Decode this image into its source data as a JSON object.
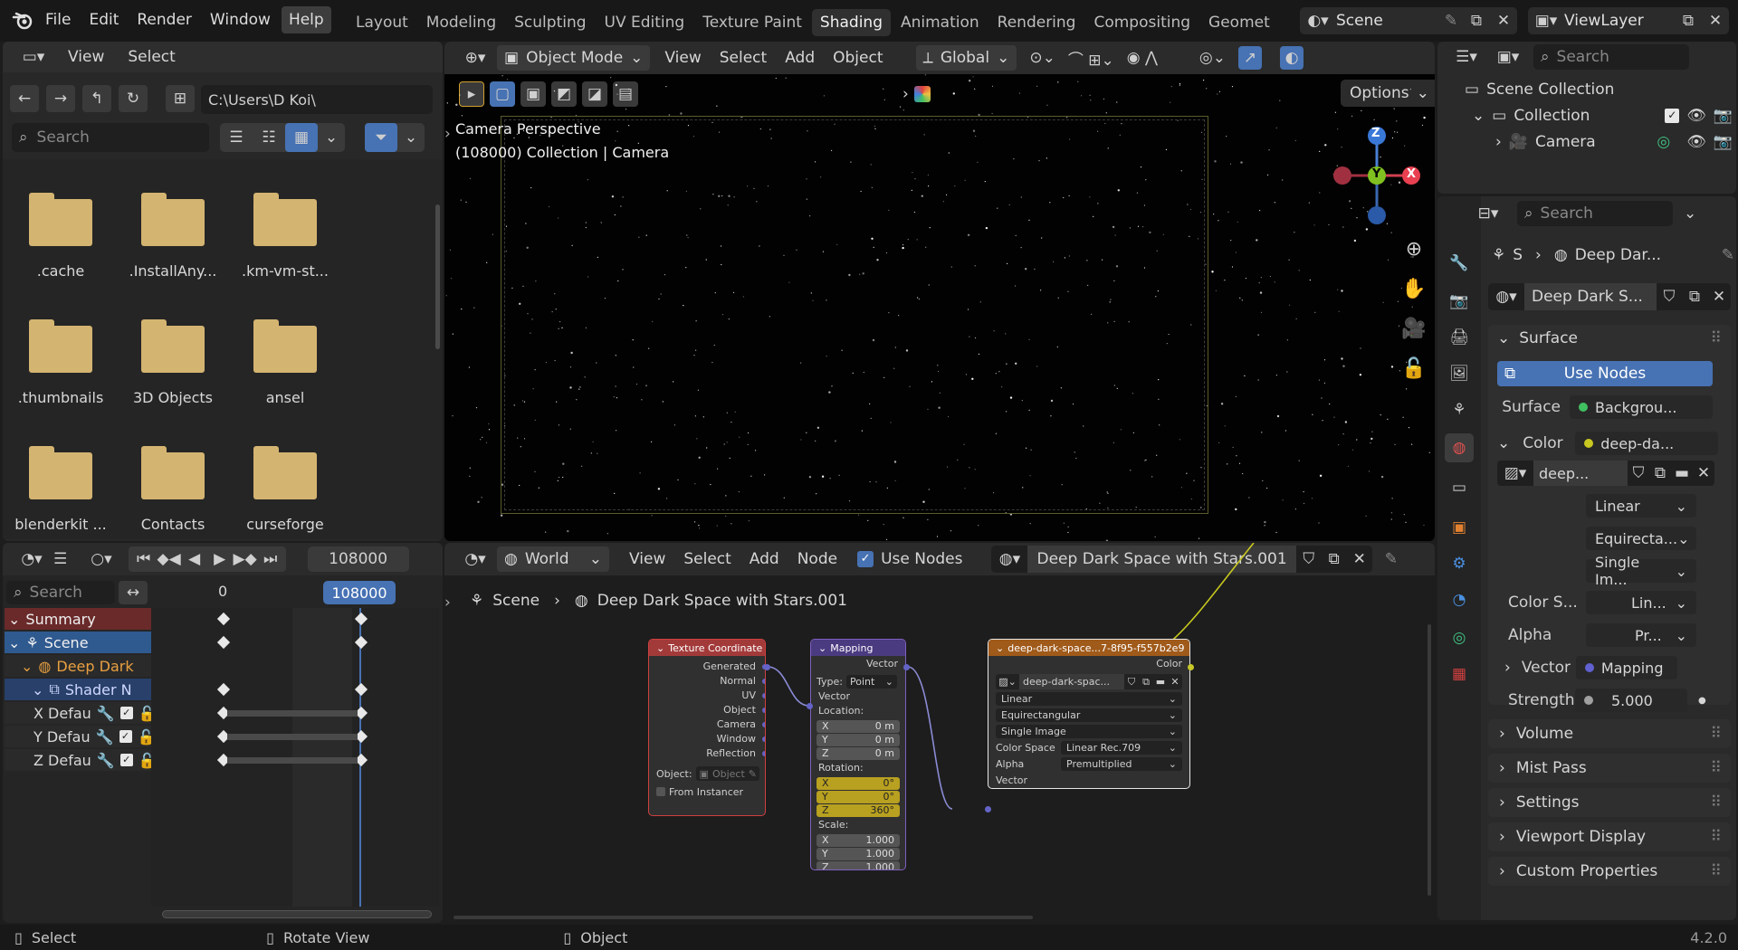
{
  "menu": {
    "file": "File",
    "edit": "Edit",
    "render": "Render",
    "window": "Window",
    "help": "Help"
  },
  "workspaces": [
    "Layout",
    "Modeling",
    "Sculpting",
    "UV Editing",
    "Texture Paint",
    "Shading",
    "Animation",
    "Rendering",
    "Compositing",
    "Geomet"
  ],
  "scene_name": "Scene",
  "view_layer": "ViewLayer",
  "filebrowser": {
    "view": "View",
    "select": "Select",
    "path": "C:\\Users\\D Koi\\",
    "search_placeholder": "Search",
    "folders": [
      ".cache",
      ".InstallAny...",
      ".km-vm-st...",
      ".thumbnails",
      "3D Objects",
      "ansel",
      "blenderkit ...",
      "Contacts",
      "curseforge"
    ]
  },
  "viewport": {
    "mode": "Object Mode",
    "view": "View",
    "select": "Select",
    "add": "Add",
    "object": "Object",
    "orientation": "Global",
    "options": "Options",
    "overlay_line1": "Camera Perspective",
    "overlay_line2": "(108000) Collection | Camera",
    "gizmo": {
      "z": "Z",
      "y": "Y",
      "x": "X"
    }
  },
  "outliner": {
    "search_placeholder": "Search",
    "scene_collection": "Scene Collection",
    "collection": "Collection",
    "camera": "Camera"
  },
  "properties": {
    "search_placeholder": "Search",
    "breadcrumb_s": "S",
    "breadcrumb_world": "Deep Dar...",
    "world_name": "Deep Dark S...",
    "surface_panel": "Surface",
    "use_nodes": "Use Nodes",
    "surface_label": "Surface",
    "surface_value": "Backgrou...",
    "color_label": "Color",
    "color_value": "deep-da...",
    "image_name": "deep...",
    "interp": "Linear",
    "projection": "Equirecta...",
    "source": "Single Im...",
    "colorspace_label": "Color S...",
    "colorspace_value": "Lin...",
    "alpha_label": "Alpha",
    "alpha_value": "Pr...",
    "vector_label": "Vector",
    "vector_value": "Mapping",
    "strength_label": "Strength",
    "strength_value": "5.000",
    "panels": [
      "Volume",
      "Mist Pass",
      "Settings",
      "Viewport Display",
      "Custom Properties"
    ]
  },
  "timeline": {
    "frame": "108000",
    "search_placeholder": "Search",
    "ruler_start": "0",
    "ruler_current": "108000",
    "channels": [
      "Summary",
      "Scene",
      "Deep Dark",
      "Shader N",
      "X Defau",
      "Y Defau",
      "Z Defau"
    ]
  },
  "node_editor": {
    "world": "World",
    "view": "View",
    "select": "Select",
    "add": "Add",
    "node": "Node",
    "use_nodes": "Use Nodes",
    "world_name": "Deep Dark Space with Stars.001",
    "breadcrumb_scene": "Scene",
    "breadcrumb_world": "Deep Dark Space with Stars.001",
    "texcoord": {
      "title": "Texture Coordinate",
      "outputs": [
        "Generated",
        "Normal",
        "UV",
        "Object",
        "Camera",
        "Window",
        "Reflection"
      ],
      "object_label": "Object:",
      "object_placeholder": "Object",
      "from_instancer": "From Instancer"
    },
    "mapping": {
      "title": "Mapping",
      "out": "Vector",
      "type_label": "Type:",
      "type_value": "Point",
      "vector_in": "Vector",
      "location": "Location:",
      "loc": [
        "0 m",
        "0 m",
        "0 m"
      ],
      "rotation": "Rotation:",
      "rot": [
        "0°",
        "0°",
        "360°"
      ],
      "scale": "Scale:",
      "scl": [
        "1.000",
        "1.000",
        "1.000"
      ],
      "axes": [
        "X",
        "Y",
        "Z"
      ]
    },
    "image": {
      "title": "deep-dark-space...7-8f95-f557b2e9",
      "out": "Color",
      "image_name": "deep-dark-spac...",
      "interp": "Linear",
      "projection": "Equirectangular",
      "source": "Single Image",
      "colorspace_label": "Color Space",
      "colorspace_value": "Linear Rec.709",
      "alpha_label": "Alpha",
      "alpha_value": "Premultiplied",
      "vector_in": "Vector"
    }
  },
  "statusbar": {
    "select": "Select",
    "rotate": "Rotate View",
    "object": "Object",
    "version": "4.2.0"
  }
}
